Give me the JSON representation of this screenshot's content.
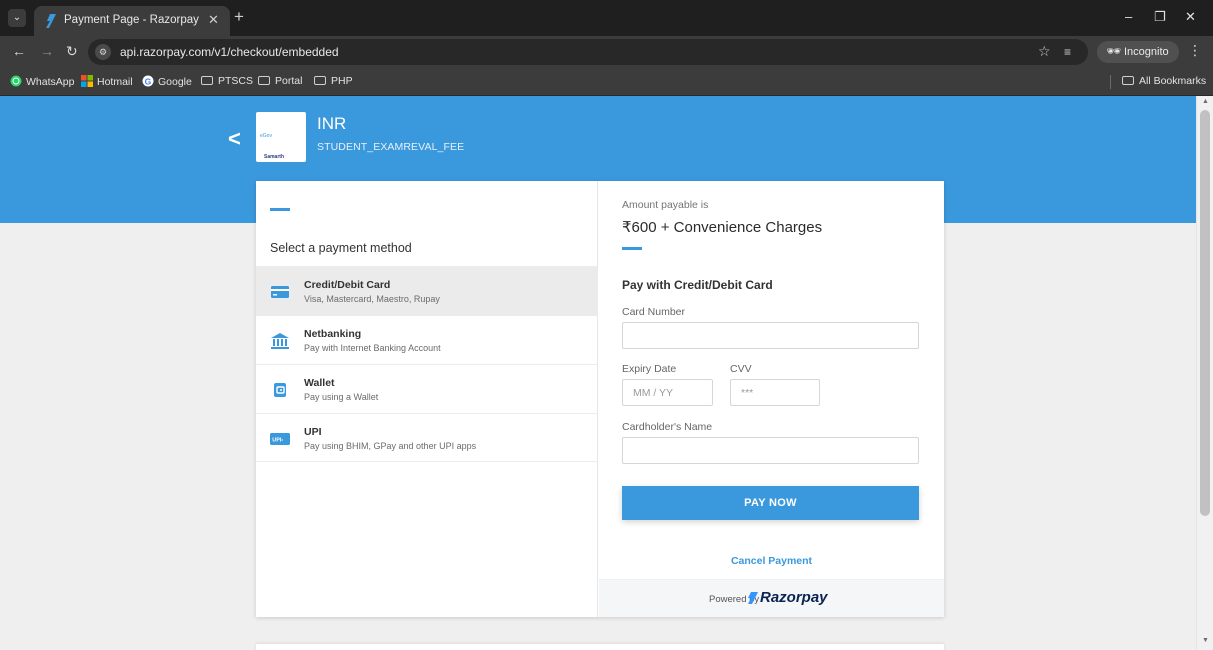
{
  "browser": {
    "tab_title": "Payment Page - Razorpay",
    "tab_close": "✕",
    "new_tab": "+",
    "url": "api.razorpay.com/v1/checkout/embedded",
    "incognito_label": "Incognito",
    "window_controls": {
      "minimize": "–",
      "restore": "❐",
      "close": "✕"
    },
    "bookmarks": [
      {
        "label": "WhatsApp",
        "icon": "whatsapp-icon"
      },
      {
        "label": "Hotmail",
        "icon": "microsoft-icon"
      },
      {
        "label": "Google",
        "icon": "google-icon"
      },
      {
        "label": "PTSCS",
        "icon": "folder-icon"
      },
      {
        "label": "Portal",
        "icon": "folder-icon"
      },
      {
        "label": "PHP",
        "icon": "folder-icon"
      }
    ],
    "all_bookmarks": "All Bookmarks"
  },
  "merchant": {
    "logo_text": "Samarth",
    "logo_text_accent": "eGov",
    "name": "INR",
    "description": "STUDENT_EXAMREVAL_FEE"
  },
  "methods_heading": "Select a payment method",
  "methods": [
    {
      "title": "Credit/Debit Card",
      "subtitle": "Visa, Mastercard, Maestro, Rupay",
      "icon": "card-icon",
      "active": true
    },
    {
      "title": "Netbanking",
      "subtitle": "Pay with Internet Banking Account",
      "icon": "bank-icon",
      "active": false
    },
    {
      "title": "Wallet",
      "subtitle": "Pay using a Wallet",
      "icon": "wallet-icon",
      "active": false
    },
    {
      "title": "UPI",
      "subtitle": "Pay using BHIM, GPay and other UPI apps",
      "icon": "upi-icon",
      "active": false
    }
  ],
  "payment": {
    "amount_label": "Amount payable is",
    "amount_value": "₹600 + Convenience Charges",
    "form_title": "Pay with Credit/Debit Card",
    "card_number_label": "Card Number",
    "card_number_value": "",
    "expiry_label": "Expiry Date",
    "expiry_placeholder": "MM / YY",
    "cvv_label": "CVV",
    "cvv_placeholder": "***",
    "name_label": "Cardholder's Name",
    "name_value": "",
    "pay_button": "PAY NOW",
    "cancel_link": "Cancel Payment",
    "powered_by": "Powered by",
    "brand": "Razorpay"
  },
  "colors": {
    "brand_blue": "#3a98dc",
    "chrome_dark": "#1f1f1f",
    "chrome_toolbar": "#3c3c3c"
  }
}
